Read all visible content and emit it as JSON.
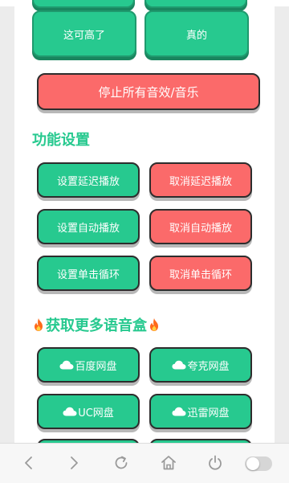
{
  "top_buttons": {
    "left_label": "这可高了",
    "right_label": "真的"
  },
  "stop_all_label": "停止所有音效/音乐",
  "function_settings": {
    "title": "功能设置",
    "set_delay_label": "设置延迟播放",
    "cancel_delay_label": "取消延迟播放",
    "set_auto_label": "设置自动播放",
    "cancel_auto_label": "取消自动播放",
    "set_loop_label": "设置单击循环",
    "cancel_loop_label": "取消单击循环"
  },
  "more_voice": {
    "title": "获取更多语音盒",
    "baidu_label": "百度网盘",
    "quark_label": "夸克网盘",
    "uc_label": "UC网盘",
    "xunlei_label": "迅雷网盘"
  },
  "colors": {
    "green": "#27c98f",
    "red": "#fb6a6a",
    "title_green": "#27c98f"
  },
  "icons": [
    "flame-icon",
    "cloud-icon",
    "back-icon",
    "forward-icon",
    "refresh-icon",
    "home-icon",
    "power-icon",
    "toggle-switch"
  ]
}
